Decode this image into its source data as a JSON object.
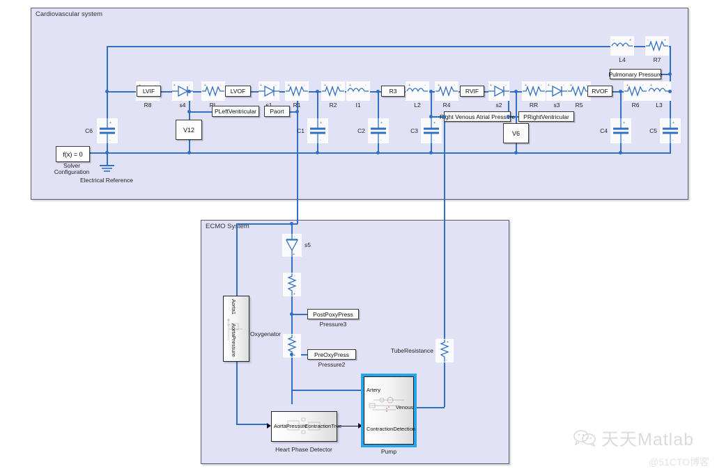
{
  "subsystems": {
    "cardiovascular": {
      "title": "Cardiovascular system"
    },
    "ecmo": {
      "title": "ECMO System"
    }
  },
  "cardiovascular": {
    "solver": {
      "equation": "f(x) = 0",
      "caption_line1": "Solver",
      "caption_line2": "Configuration"
    },
    "ground": {
      "label": "Electrical Reference"
    },
    "components": [
      {
        "id": "C6",
        "label": "C6",
        "type": "capacitor"
      },
      {
        "id": "R8",
        "label": "R8",
        "type": "resistor"
      },
      {
        "id": "s4",
        "label": "s4",
        "type": "diode"
      },
      {
        "id": "RL",
        "label": "RL",
        "type": "resistor"
      },
      {
        "id": "s1",
        "label": "s1",
        "type": "diode"
      },
      {
        "id": "R1",
        "label": "R1",
        "type": "resistor"
      },
      {
        "id": "R2",
        "label": "R2",
        "type": "resistor"
      },
      {
        "id": "I1",
        "label": "I1",
        "type": "inductor"
      },
      {
        "id": "L2",
        "label": "L2",
        "type": "inductor"
      },
      {
        "id": "R4",
        "label": "R4",
        "type": "resistor"
      },
      {
        "id": "s2",
        "label": "s2",
        "type": "diode"
      },
      {
        "id": "RR",
        "label": "RR",
        "type": "resistor"
      },
      {
        "id": "s3",
        "label": "s3",
        "type": "diode"
      },
      {
        "id": "R5",
        "label": "R5",
        "type": "resistor"
      },
      {
        "id": "R6",
        "label": "R6",
        "type": "resistor"
      },
      {
        "id": "L3",
        "label": "L3",
        "type": "inductor"
      },
      {
        "id": "L4",
        "label": "L4",
        "type": "inductor"
      },
      {
        "id": "R7",
        "label": "R7",
        "type": "resistor"
      },
      {
        "id": "C1",
        "label": "C1",
        "type": "capacitor"
      },
      {
        "id": "C2",
        "label": "C2",
        "type": "capacitor"
      },
      {
        "id": "C3",
        "label": "C3",
        "type": "capacitor"
      },
      {
        "id": "C4",
        "label": "C4",
        "type": "capacitor"
      },
      {
        "id": "C5",
        "label": "C5",
        "type": "capacitor"
      }
    ],
    "blocks": [
      {
        "id": "LVIF",
        "label": "LVIF"
      },
      {
        "id": "LVOF",
        "label": "LVOF"
      },
      {
        "id": "R3",
        "label": "R3"
      },
      {
        "id": "RVIF",
        "label": "RVIF"
      },
      {
        "id": "RVOF",
        "label": "RVOF"
      },
      {
        "id": "V12",
        "label": "V12"
      },
      {
        "id": "V6",
        "label": "V6"
      },
      {
        "id": "PLeftVentricular",
        "label": "PLeftVentricular"
      },
      {
        "id": "Paort",
        "label": "Paort"
      },
      {
        "id": "PRightVentricular",
        "label": "PRightVentricular"
      },
      {
        "id": "RightVenousAtrialPressure",
        "label": "Right Venous Atrial Pressure"
      },
      {
        "id": "PulmonaryPressure",
        "label": "Pulmonary Pressure"
      }
    ]
  },
  "ecmo": {
    "components": [
      {
        "id": "s5",
        "label": "s5",
        "type": "diode-vertical"
      },
      {
        "id": "Rtop",
        "label": "",
        "type": "resistor-vertical"
      },
      {
        "id": "Rox",
        "label": "",
        "type": "resistor-vertical"
      },
      {
        "id": "TubeResistance",
        "label": "TubeResistance",
        "type": "resistor-vertical"
      }
    ],
    "blocks": [
      {
        "id": "PostPoxyPress",
        "label": "PostPoxyPress",
        "caption": "Pressure3"
      },
      {
        "id": "PreOxyPress",
        "label": "PreOxyPress",
        "caption": "Pressure2"
      }
    ],
    "aorta": {
      "port_label": "Aorta1",
      "signal_label": "AortaPressure"
    },
    "oxygenator_label": "Oxygenator",
    "heart_phase_detector": {
      "caption": "Heart Phase Detector",
      "input_port": "AortaPressure",
      "output_port": "ContractionTrue"
    },
    "pump": {
      "caption": "Pump",
      "port_artery": "Artery",
      "port_venous": "Venous",
      "port_contraction": "ContractionDetection"
    }
  },
  "watermark": {
    "brand": "天天Matlab",
    "account": "@51CTO博客"
  },
  "colors": {
    "wire": "#2f6fc4",
    "subsystem_fill": "#e2e2f7",
    "subsystem_border": "#5a5a6e",
    "selection": "#27a5e8",
    "block_border": "#3a3a3a"
  }
}
